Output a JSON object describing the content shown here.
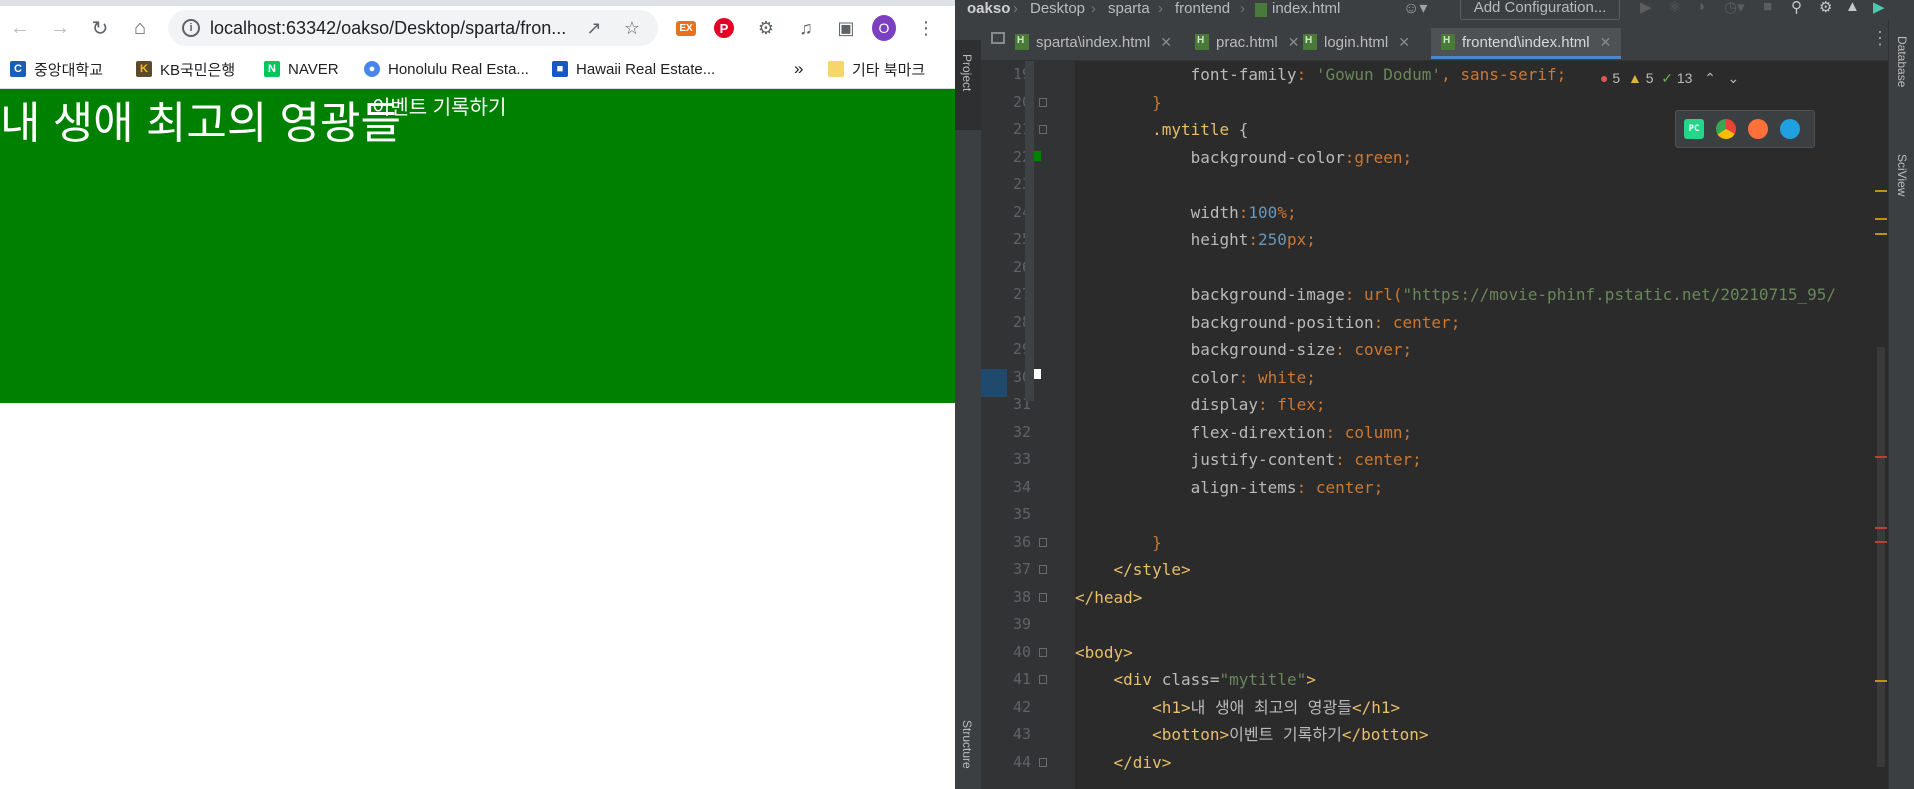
{
  "browser": {
    "url": "localhost:63342/oakso/Desktop/sparta/fron...",
    "profile_initial": "O",
    "extension_label": "EX",
    "bookmarks": [
      {
        "label": "중앙대학교",
        "icon": "cau-icon"
      },
      {
        "label": "KB국민은행",
        "icon": "kb-icon"
      },
      {
        "label": "NAVER",
        "icon": "naver-icon"
      },
      {
        "label": "Honolulu Real Esta...",
        "icon": "pin-icon"
      },
      {
        "label": "Hawaii Real Estate...",
        "icon": "building-icon"
      }
    ],
    "more_bookmarks": "»",
    "other_bookmarks": "기타 북마크",
    "page": {
      "h1": "내 생애 최고의 영광들",
      "button": "이벤트 기록하기",
      "title_bg": "#008000"
    }
  },
  "ide": {
    "breadcrumbs": [
      "oakso",
      "Desktop",
      "sparta",
      "frontend",
      "index.html"
    ],
    "add_configuration": "Add Configuration...",
    "left_tools": [
      "Project",
      "Structure"
    ],
    "right_tools": [
      "Database",
      "SciView"
    ],
    "tabs": [
      {
        "label": "sparta\\index.html",
        "active": false
      },
      {
        "label": "prac.html",
        "active": false
      },
      {
        "label": "login.html",
        "active": false
      },
      {
        "label": "frontend\\index.html",
        "active": true
      }
    ],
    "inspections": {
      "errors": "5",
      "warnings": "5",
      "ok": "13"
    },
    "browser_icons": [
      "pycharm-icon",
      "chrome-icon",
      "firefox-icon",
      "edge-icon"
    ],
    "line_numbers": [
      "19",
      "20",
      "21",
      "22",
      "23",
      "24",
      "25",
      "26",
      "27",
      "28",
      "29",
      "30",
      "31",
      "32",
      "33",
      "34",
      "35",
      "36",
      "37",
      "38",
      "39",
      "40",
      "41",
      "42",
      "43",
      "44"
    ],
    "code": [
      {
        "i": "            ",
        "t": [
          [
            "prop",
            "font-family"
          ],
          [
            "pun",
            ": "
          ],
          [
            "str",
            "'Gowun Dodum'"
          ],
          [
            "pun",
            ", "
          ],
          [
            "val",
            "sans-serif"
          ],
          [
            "pun",
            ";"
          ]
        ]
      },
      {
        "i": "        ",
        "t": [
          [
            "pun",
            "}"
          ]
        ]
      },
      {
        "i": "        ",
        "t": [
          [
            "sel",
            ".mytitle"
          ],
          [
            "prop",
            " {"
          ]
        ]
      },
      {
        "i": "            ",
        "t": [
          [
            "prop",
            "background-color"
          ],
          [
            "pun",
            ":"
          ],
          [
            "val",
            "green"
          ],
          [
            "pun",
            ";"
          ]
        ]
      },
      {
        "i": "",
        "t": []
      },
      {
        "i": "            ",
        "t": [
          [
            "prop",
            "width"
          ],
          [
            "pun",
            ":"
          ],
          [
            "num",
            "100"
          ],
          [
            "val",
            "%"
          ],
          [
            "pun",
            ";"
          ]
        ]
      },
      {
        "i": "            ",
        "t": [
          [
            "prop",
            "height"
          ],
          [
            "pun",
            ":"
          ],
          [
            "num",
            "250"
          ],
          [
            "val",
            "px"
          ],
          [
            "pun",
            ";"
          ]
        ]
      },
      {
        "i": "",
        "t": []
      },
      {
        "i": "            ",
        "t": [
          [
            "prop",
            "background-image"
          ],
          [
            "pun",
            ": "
          ],
          [
            "val",
            "url("
          ],
          [
            "str",
            "\"https://movie-phinf.pstatic.net/20210715_95/"
          ]
        ]
      },
      {
        "i": "            ",
        "t": [
          [
            "prop",
            "background-position"
          ],
          [
            "pun",
            ": "
          ],
          [
            "val",
            "center"
          ],
          [
            "pun",
            ";"
          ]
        ]
      },
      {
        "i": "            ",
        "t": [
          [
            "prop",
            "background-size"
          ],
          [
            "pun",
            ": "
          ],
          [
            "val",
            "cover"
          ],
          [
            "pun",
            ";"
          ]
        ]
      },
      {
        "i": "            ",
        "t": [
          [
            "prop",
            "color"
          ],
          [
            "pun",
            ": "
          ],
          [
            "val",
            "white"
          ],
          [
            "pun",
            ";"
          ]
        ]
      },
      {
        "i": "            ",
        "t": [
          [
            "prop",
            "display"
          ],
          [
            "pun",
            ": "
          ],
          [
            "val",
            "flex"
          ],
          [
            "pun",
            ";"
          ]
        ]
      },
      {
        "i": "            ",
        "t": [
          [
            "prop",
            "flex-dirextion"
          ],
          [
            "pun",
            ": "
          ],
          [
            "val",
            "column"
          ],
          [
            "pun",
            ";"
          ]
        ]
      },
      {
        "i": "            ",
        "t": [
          [
            "prop",
            "justify-content"
          ],
          [
            "pun",
            ": "
          ],
          [
            "val",
            "center"
          ],
          [
            "pun",
            ";"
          ]
        ]
      },
      {
        "i": "            ",
        "t": [
          [
            "prop",
            "align-items"
          ],
          [
            "pun",
            ": "
          ],
          [
            "val",
            "center"
          ],
          [
            "pun",
            ";"
          ]
        ]
      },
      {
        "i": "",
        "t": []
      },
      {
        "i": "        ",
        "t": [
          [
            "pun",
            "}"
          ]
        ]
      },
      {
        "i": "    ",
        "t": [
          [
            "tag",
            "</style>"
          ]
        ]
      },
      {
        "i": "",
        "t": [
          [
            "tag",
            "</head>"
          ]
        ]
      },
      {
        "i": "",
        "t": []
      },
      {
        "i": "",
        "t": [
          [
            "tag",
            "<body>"
          ]
        ]
      },
      {
        "i": "    ",
        "t": [
          [
            "tag",
            "<div "
          ],
          [
            "attr",
            "class"
          ],
          [
            "prop",
            "="
          ],
          [
            "str",
            "\"mytitle\""
          ],
          [
            "tag",
            ">"
          ]
        ]
      },
      {
        "i": "        ",
        "t": [
          [
            "tag",
            "<h1>"
          ],
          [
            "prop",
            "내 생애 최고의 영광들"
          ],
          [
            "tag",
            "</h1>"
          ]
        ]
      },
      {
        "i": "        ",
        "t": [
          [
            "tag",
            "<botton>"
          ],
          [
            "prop",
            "이벤트 기록하기"
          ],
          [
            "tag",
            "</botton>"
          ]
        ]
      },
      {
        "i": "    ",
        "t": [
          [
            "tag",
            "</div>"
          ]
        ]
      }
    ],
    "colors": {
      "selector": "#e8bf6a",
      "keyword": "#cc7832",
      "number": "#6897bb",
      "string": "#6a8759",
      "text": "#a9b7c6"
    }
  }
}
